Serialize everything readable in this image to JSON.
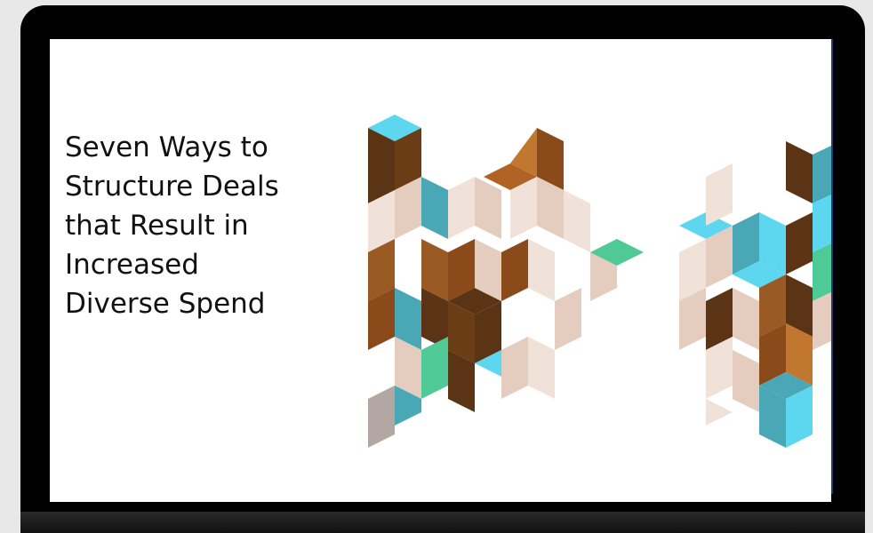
{
  "slide": {
    "title_lines": [
      "Seven Ways to",
      "Structure Deals",
      "that Result in",
      "Increased",
      "Diverse Spend"
    ]
  },
  "colors": {
    "device_frame": "#000000",
    "slide_background": "#ffffff",
    "title_text": "#111111",
    "pattern_dark_brown": "#5a3414",
    "pattern_brown": "#9a5a24",
    "pattern_tan": "#e4cdbf",
    "pattern_light_tan": "#f0e2d8",
    "pattern_cyan": "#5dd6ef",
    "pattern_teal": "#4aa7b5",
    "pattern_green": "#4fc996",
    "pattern_gray": "#b3a7a3"
  },
  "decoration": {
    "pattern_icon": "geometric-cube-pattern"
  }
}
